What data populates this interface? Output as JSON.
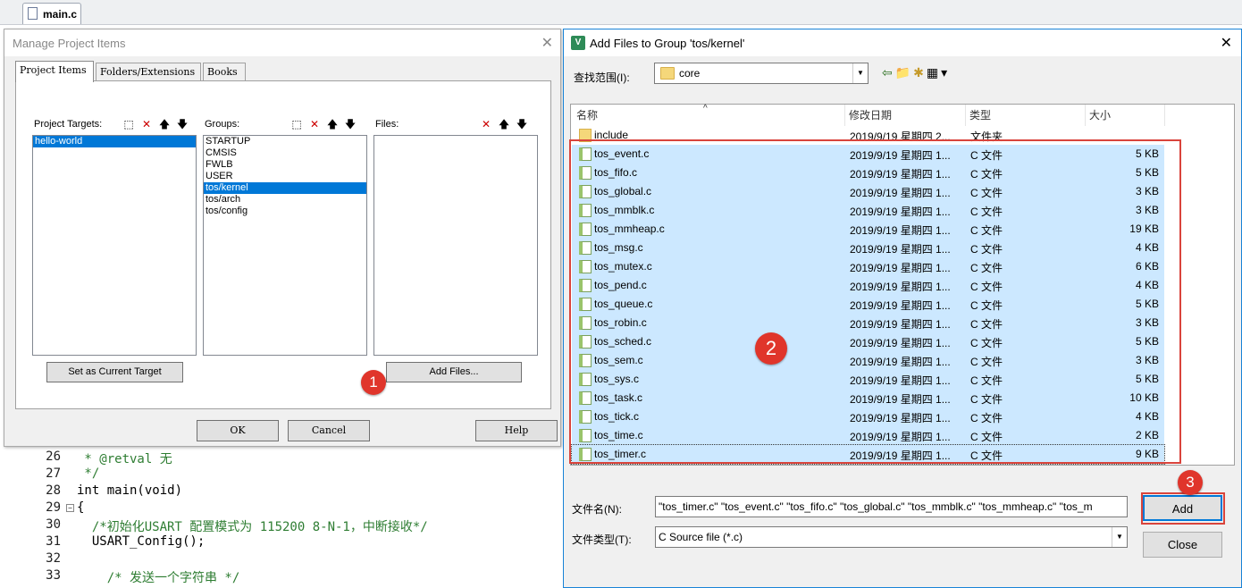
{
  "editor": {
    "tab": "main.c",
    "lines": [
      {
        "num": "26",
        "text": " * @retval 无",
        "fold": "",
        "cls": "cm"
      },
      {
        "num": "27",
        "text": " */",
        "fold": "",
        "cls": "cm"
      },
      {
        "num": "28",
        "text": "int main(void)",
        "fold": "",
        "cls": ""
      },
      {
        "num": "29",
        "text": "{",
        "fold": "⊟",
        "cls": ""
      },
      {
        "num": "30",
        "text": "  /*初始化USART 配置模式为 115200 8-N-1，中断接收*/",
        "fold": "",
        "cls": "cm"
      },
      {
        "num": "31",
        "text": "  USART_Config();",
        "fold": "",
        "cls": ""
      },
      {
        "num": "32",
        "text": "",
        "fold": "",
        "cls": ""
      },
      {
        "num": "33",
        "text": "    /* 发送一个字符串 */",
        "fold": "",
        "cls": "cm"
      }
    ]
  },
  "manage_dialog": {
    "title": "Manage Project Items",
    "close": "✕",
    "tabs": [
      "Project Items",
      "Folders/Extensions",
      "Books"
    ],
    "targets_label": "Project Targets:",
    "groups_label": "Groups:",
    "files_label": "Files:",
    "targets": [
      {
        "label": "hello-world",
        "selected": true
      }
    ],
    "groups": [
      {
        "label": "STARTUP",
        "selected": false
      },
      {
        "label": "CMSIS",
        "selected": false
      },
      {
        "label": "FWLB",
        "selected": false
      },
      {
        "label": "USER",
        "selected": false
      },
      {
        "label": "tos/kernel",
        "selected": true
      },
      {
        "label": "tos/arch",
        "selected": false
      },
      {
        "label": "tos/config",
        "selected": false
      }
    ],
    "set_current_label": "Set as Current Target",
    "add_files_label": "Add Files...",
    "ok_label": "OK",
    "cancel_label": "Cancel",
    "help_label": "Help",
    "badge1": "1"
  },
  "add_dialog": {
    "title": "Add Files to Group 'tos/kernel'",
    "close": "✕",
    "lookin_label": "查找范围(I):",
    "lookin_value": "core",
    "columns": {
      "name": "名称",
      "date": "修改日期",
      "type": "类型",
      "size": "大小"
    },
    "files": [
      {
        "name": "include",
        "date": "2019/9/19 星期四 2...",
        "type": "文件夹",
        "size": "",
        "kind": "dir",
        "selected": false
      },
      {
        "name": "tos_event.c",
        "date": "2019/9/19 星期四 1...",
        "type": "C 文件",
        "size": "5 KB",
        "kind": "c",
        "selected": true
      },
      {
        "name": "tos_fifo.c",
        "date": "2019/9/19 星期四 1...",
        "type": "C 文件",
        "size": "5 KB",
        "kind": "c",
        "selected": true
      },
      {
        "name": "tos_global.c",
        "date": "2019/9/19 星期四 1...",
        "type": "C 文件",
        "size": "3 KB",
        "kind": "c",
        "selected": true
      },
      {
        "name": "tos_mmblk.c",
        "date": "2019/9/19 星期四 1...",
        "type": "C 文件",
        "size": "3 KB",
        "kind": "c",
        "selected": true
      },
      {
        "name": "tos_mmheap.c",
        "date": "2019/9/19 星期四 1...",
        "type": "C 文件",
        "size": "19 KB",
        "kind": "c",
        "selected": true
      },
      {
        "name": "tos_msg.c",
        "date": "2019/9/19 星期四 1...",
        "type": "C 文件",
        "size": "4 KB",
        "kind": "c",
        "selected": true
      },
      {
        "name": "tos_mutex.c",
        "date": "2019/9/19 星期四 1...",
        "type": "C 文件",
        "size": "6 KB",
        "kind": "c",
        "selected": true
      },
      {
        "name": "tos_pend.c",
        "date": "2019/9/19 星期四 1...",
        "type": "C 文件",
        "size": "4 KB",
        "kind": "c",
        "selected": true
      },
      {
        "name": "tos_queue.c",
        "date": "2019/9/19 星期四 1...",
        "type": "C 文件",
        "size": "5 KB",
        "kind": "c",
        "selected": true
      },
      {
        "name": "tos_robin.c",
        "date": "2019/9/19 星期四 1...",
        "type": "C 文件",
        "size": "3 KB",
        "kind": "c",
        "selected": true
      },
      {
        "name": "tos_sched.c",
        "date": "2019/9/19 星期四 1...",
        "type": "C 文件",
        "size": "5 KB",
        "kind": "c",
        "selected": true
      },
      {
        "name": "tos_sem.c",
        "date": "2019/9/19 星期四 1...",
        "type": "C 文件",
        "size": "3 KB",
        "kind": "c",
        "selected": true
      },
      {
        "name": "tos_sys.c",
        "date": "2019/9/19 星期四 1...",
        "type": "C 文件",
        "size": "5 KB",
        "kind": "c",
        "selected": true
      },
      {
        "name": "tos_task.c",
        "date": "2019/9/19 星期四 1...",
        "type": "C 文件",
        "size": "10 KB",
        "kind": "c",
        "selected": true
      },
      {
        "name": "tos_tick.c",
        "date": "2019/9/19 星期四 1...",
        "type": "C 文件",
        "size": "4 KB",
        "kind": "c",
        "selected": true
      },
      {
        "name": "tos_time.c",
        "date": "2019/9/19 星期四 1...",
        "type": "C 文件",
        "size": "2 KB",
        "kind": "c",
        "selected": true
      },
      {
        "name": "tos_timer.c",
        "date": "2019/9/19 星期四 1...",
        "type": "C 文件",
        "size": "9 KB",
        "kind": "c",
        "selected": true
      }
    ],
    "filename_label": "文件名(N):",
    "filename_value": "\"tos_timer.c\" \"tos_event.c\" \"tos_fifo.c\" \"tos_global.c\" \"tos_mmblk.c\" \"tos_mmheap.c\" \"tos_m",
    "filetype_label": "文件类型(T):",
    "filetype_value": "C Source file (*.c)",
    "add_label": "Add",
    "close_label": "Close",
    "badge2": "2",
    "badge3": "3"
  },
  "colors": {
    "selection": "#cce8ff",
    "list_selection": "#0078d7",
    "annotation": "#d9443c"
  }
}
